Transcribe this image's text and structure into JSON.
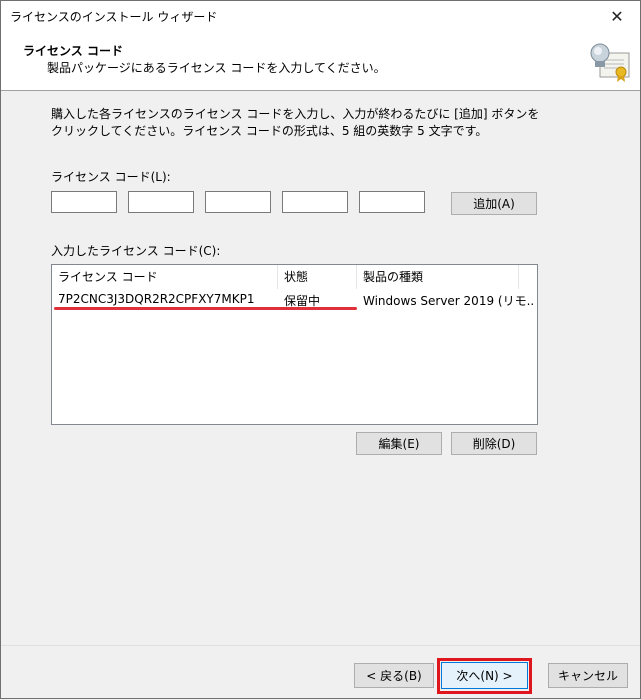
{
  "window": {
    "title": "ライセンスのインストール ウィザード",
    "close_glyph": "✕"
  },
  "header": {
    "title": "ライセンス コード",
    "subtitle": "製品パッケージにあるライセンス コードを入力してください。",
    "icon": "certificate-icon"
  },
  "body": {
    "description": "購入した各ライセンスのライセンス コードを入力し、入力が終わるたびに [追加] ボタンをクリックしてください。ライセンス コードの形式は、5 組の英数字 5 文字です。",
    "code_label": "ライセンス コード(L):",
    "code_fields": [
      "",
      "",
      "",
      "",
      ""
    ],
    "add_button": "追加(A)",
    "list_label": "入力したライセンス コード(C):",
    "list": {
      "columns": [
        "ライセンス コード",
        "状態",
        "製品の種類"
      ],
      "rows": [
        [
          "7P2CNC3J3DQR2R2CPFXY7MKP1",
          "保留中",
          "Windows Server 2019 (リモ..."
        ]
      ]
    },
    "edit_button": "編集(E)",
    "delete_button": "削除(D)"
  },
  "footer": {
    "back_button": "< 戻る(B)",
    "next_button": "次へ(N) >",
    "cancel_button": "キャンセル"
  },
  "colors": {
    "highlight": "#e0161e",
    "underline": "#e0303a"
  }
}
